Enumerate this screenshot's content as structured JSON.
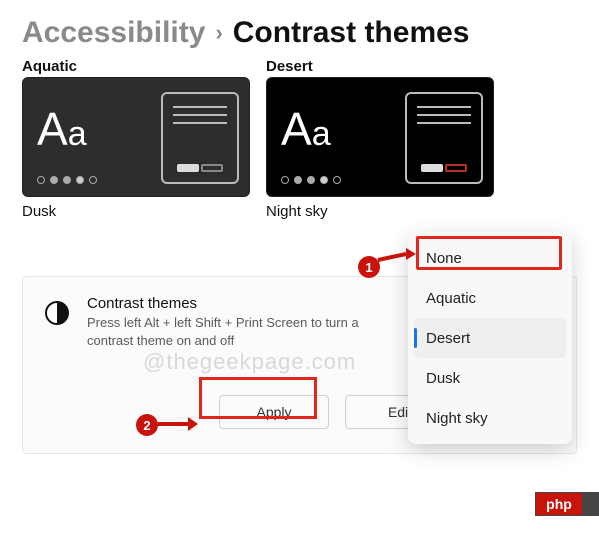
{
  "breadcrumb": {
    "parent": "Accessibility",
    "current": "Contrast themes"
  },
  "themes": [
    {
      "label_top": "Aquatic",
      "label_bottom": "Dusk"
    },
    {
      "label_top": "Desert",
      "label_bottom": "Night sky"
    }
  ],
  "card": {
    "title": "Contrast themes",
    "description": "Press left Alt + left Shift + Print Screen to turn a contrast theme on and off",
    "apply": "Apply",
    "edit": "Edit"
  },
  "dropdown": {
    "items": [
      "None",
      "Aquatic",
      "Desert",
      "Dusk",
      "Night sky"
    ],
    "selected_index": 2
  },
  "watermark": "@thegeekpage.com",
  "annotations": {
    "badge1": "1",
    "badge2": "2"
  },
  "colors": {
    "highlight": "#e1261c"
  },
  "footer_tag": "php"
}
